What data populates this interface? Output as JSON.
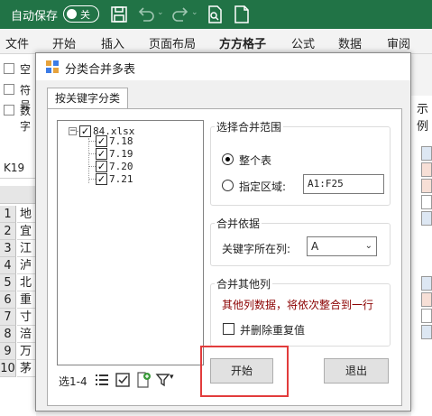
{
  "titlebar": {
    "autosave_label": "自动保存",
    "toggle_state": "关",
    "icons": [
      "save-icon",
      "undo-icon",
      "redo-icon",
      "print-preview-icon",
      "new-sheet-icon"
    ]
  },
  "ribbon": {
    "tabs": [
      "文件",
      "开始",
      "插入",
      "页面布局",
      "方方格子",
      "公式",
      "数据",
      "审阅"
    ]
  },
  "background": {
    "options": [
      "空",
      "符号",
      "数字"
    ],
    "namebox": "K19",
    "rows": [
      {
        "num": "1",
        "cell": "地"
      },
      {
        "num": "2",
        "cell": "宜"
      },
      {
        "num": "3",
        "cell": "江"
      },
      {
        "num": "4",
        "cell": "泸"
      },
      {
        "num": "5",
        "cell": "北"
      },
      {
        "num": "6",
        "cell": "重"
      },
      {
        "num": "7",
        "cell": "寸"
      },
      {
        "num": "8",
        "cell": "涪"
      },
      {
        "num": "9",
        "cell": "万"
      },
      {
        "num": "10",
        "cell": "茅"
      }
    ],
    "right_hint": "示例"
  },
  "dialog": {
    "title": "分类合并多表",
    "tab": "按关键字分类",
    "tree": {
      "root": "84.xlsx",
      "children": [
        "7.18",
        "7.19",
        "7.20",
        "7.21"
      ]
    },
    "bottombar": {
      "select_label": "选1-4"
    },
    "range_group": {
      "title": "选择合并范围",
      "option_whole": "整个表",
      "option_range": "指定区域:",
      "range_value": "A1:F25"
    },
    "basis_group": {
      "title": "合并依据",
      "key_column_label": "关键字所在列:",
      "key_column_value": "A"
    },
    "other_group": {
      "title": "合并其他列",
      "note": "其他列数据，将依次整合到一行",
      "dedupe_label": "并删除重复值"
    },
    "start_button": "开始",
    "exit_button": "退出"
  },
  "colors": {
    "excel_green": "#217346",
    "note_red": "#8b0000",
    "highlight": "#e23c3c"
  }
}
